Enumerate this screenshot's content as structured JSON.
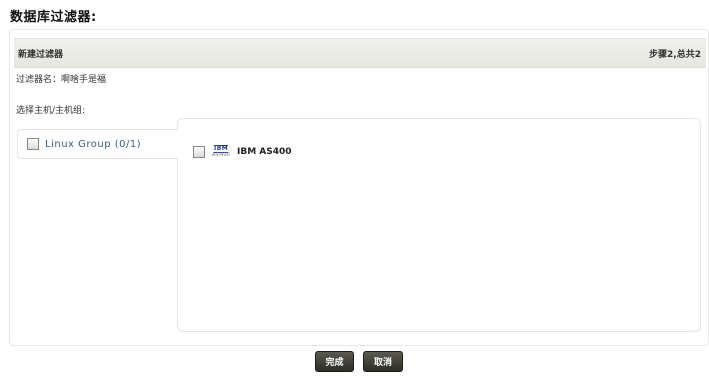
{
  "page": {
    "title": "数据库过滤器:"
  },
  "panel": {
    "header_title": "新建过滤器",
    "step_text": "步骤2,总共2",
    "filter_name_label": "过滤器名：",
    "filter_name_value": "啊啥手是福",
    "select_label": "选择主机/主机组:"
  },
  "groups": [
    {
      "label": "Linux Group (0/1)",
      "checked": false
    }
  ],
  "hosts": [
    {
      "label": "IBM AS400",
      "logo_text": "IBM",
      "logo_subtext": "AS/400",
      "icon": "ibm-as400-icon",
      "checked": false
    }
  ],
  "buttons": {
    "finish": "完成",
    "cancel": "取消"
  },
  "colors": {
    "header_bg": "#ece9e3",
    "group_link": "#3b5f8a",
    "button_bg": "#3a3a33",
    "ibm_blue": "#2a3d8f"
  }
}
